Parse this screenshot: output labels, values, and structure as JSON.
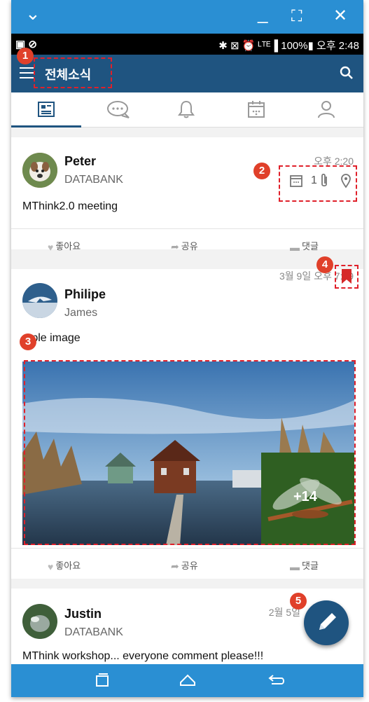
{
  "window": {
    "minimize": "_",
    "maximize": "⛶",
    "close": "✕",
    "collapse": "⌄"
  },
  "status": {
    "left": "▣ ⊘",
    "right": "✱ ⊠ ⏰ ᴸᵀᴱ▐ 100%▮ 오후 2:48"
  },
  "appbar": {
    "title": "전체소식"
  },
  "tabs": [
    "news",
    "chat",
    "notifications",
    "calendar",
    "profile"
  ],
  "posts": [
    {
      "name": "Peter",
      "sub": "DATABANK",
      "time": "오후 2:20",
      "body": "MThink2.0 meeting",
      "attach_count": "1"
    },
    {
      "name": "Philipe",
      "sub": "James",
      "time": "3월 9일 오후 7:49",
      "body": "mple image",
      "more_images": "+14"
    },
    {
      "name": "Justin",
      "sub": "DATABANK",
      "time": "2월 5일",
      "body": "MThink workshop... everyone comment please!!!"
    }
  ],
  "actions": {
    "like": "좋아요",
    "share": "공유",
    "comment": "댓글"
  },
  "callouts": [
    "1",
    "2",
    "3",
    "4",
    "5"
  ],
  "colors": {
    "appbar": "#1f5480",
    "window": "#2a8fd3",
    "callout": "#e0202a"
  }
}
